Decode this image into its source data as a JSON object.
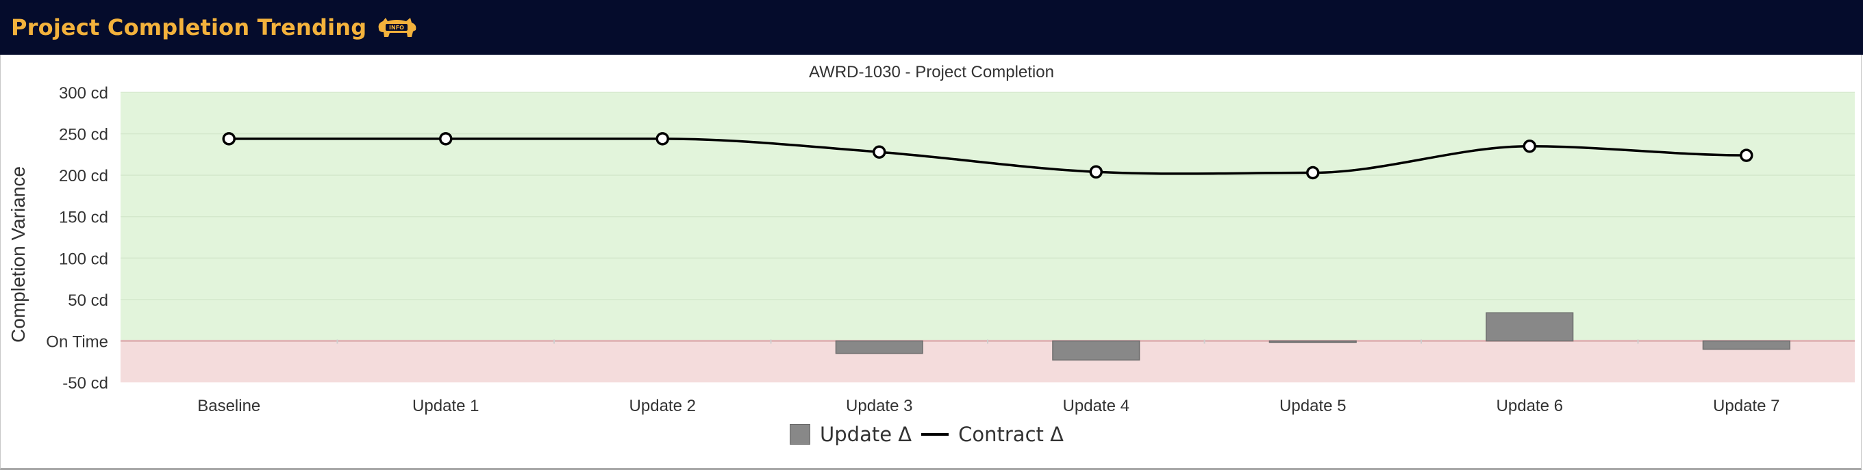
{
  "header": {
    "title": "Project Completion Trending",
    "info_badge_text": "INFO"
  },
  "colors": {
    "header_bg": "#050c2c",
    "title": "#f3b23c",
    "on_time_band": "#e2f4db",
    "late_band": "#f4dcdc",
    "bar_fill": "#888888",
    "line": "#000000"
  },
  "chart_data": {
    "type": "bar",
    "title": "AWRD-1030 - Project Completion",
    "ylabel": "Completion Variance",
    "xlabel": "",
    "categories": [
      "Baseline",
      "Update 1",
      "Update 2",
      "Update 3",
      "Update 4",
      "Update 5",
      "Update 6",
      "Update 7"
    ],
    "ylim": [
      -50,
      300
    ],
    "y_ticks": [
      {
        "value": 300,
        "label": "300 cd"
      },
      {
        "value": 250,
        "label": "250 cd"
      },
      {
        "value": 200,
        "label": "200 cd"
      },
      {
        "value": 150,
        "label": "150 cd"
      },
      {
        "value": 100,
        "label": "100 cd"
      },
      {
        "value": 50,
        "label": "50 cd"
      },
      {
        "value": 0,
        "label": "On Time"
      },
      {
        "value": -50,
        "label": "-50 cd"
      }
    ],
    "grid": true,
    "legend_position": "bottom",
    "series": [
      {
        "name": "Update Δ",
        "type": "bar",
        "values": [
          0,
          0,
          0,
          -15,
          -23,
          -1,
          34,
          -10
        ]
      },
      {
        "name": "Contract Δ",
        "type": "line",
        "smooth": true,
        "values": [
          244,
          244,
          244,
          228,
          204,
          203,
          235,
          224
        ]
      }
    ]
  }
}
